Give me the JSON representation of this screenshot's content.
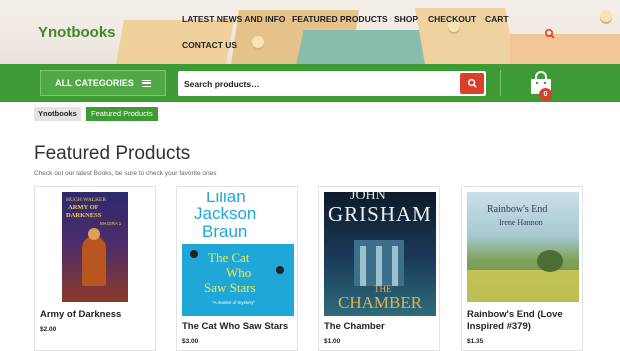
{
  "site": {
    "logo": "Ynotbooks"
  },
  "nav": {
    "items": [
      {
        "label": "LATEST NEWS AND INFO"
      },
      {
        "label": "FEATURED PRODUCTS"
      },
      {
        "label": "SHOP"
      },
      {
        "label": "CHECKOUT"
      },
      {
        "label": "CART"
      },
      {
        "label": "CONTACT US"
      }
    ],
    "search_icon": "search-icon"
  },
  "toolbar": {
    "categories_label": "ALL CATEGORIES",
    "search_placeholder": "Search products…",
    "cart_count": "0",
    "accent_color": "#3e9a34",
    "search_button_color": "#d9402c"
  },
  "breadcrumb": {
    "home": "Ynotbooks",
    "current": "Featured Products"
  },
  "page": {
    "title": "Featured Products",
    "subtitle": "Check out our latest Books, be sure to check your favorite ones"
  },
  "products": [
    {
      "name": "Army of Darkness",
      "price": "$2.00",
      "cover": {
        "author": "HUGH WALKER",
        "title_lines": [
          "ARMY OF",
          "DARKNESS"
        ],
        "series": "MAGIRA 1"
      }
    },
    {
      "name": "The Cat Who Saw Stars",
      "price": "$3.00",
      "cover": {
        "author_lines": [
          "Lilian",
          "Jackson",
          "Braun"
        ],
        "title_lines": [
          "The Cat",
          "Who",
          "Saw Stars"
        ],
        "blurb": "\"A master of mystery\""
      }
    },
    {
      "name": "The Chamber",
      "price": "$1.00",
      "cover": {
        "author_lines": [
          "JOHN",
          "GRISHAM"
        ],
        "title_lines": [
          "THE",
          "CHAMBER"
        ]
      }
    },
    {
      "name": "Rainbow's End (Love Inspired #379)",
      "price": "$1.35",
      "cover": {
        "title": "Rainbow's End",
        "author": "Irene Hannon"
      }
    }
  ]
}
